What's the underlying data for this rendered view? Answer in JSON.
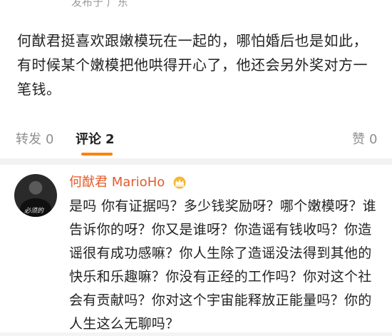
{
  "post": {
    "location": "发布于 广东",
    "text": "何猷君挺喜欢跟嫩模玩在一起的，哪怕婚后也是如此，有时候某个嫩模把他哄得开心了，他还会另外奖对方一笔钱。"
  },
  "actions": {
    "repost_label": "转发",
    "repost_count": "0",
    "comments_label": "评论",
    "comments_count": "2",
    "like_label": "赞",
    "like_count": "0"
  },
  "comment": {
    "username": "何猷君 MarioHo",
    "badge_icon": "crown-icon",
    "avatar_text": "必须的",
    "text": "是吗 你有证据吗？多少钱奖励呀？哪个嫩模呀？谁告诉你的呀？你又是谁呀？你造谣有钱收吗？你造谣很有成功感嘛？你人生除了造谣没法得到其他的快乐和乐趣嘛？你没有正经的工作吗？你对这个社会有贡献吗？你对这个宇宙能释放正能量吗？你的人生这么无聊吗？"
  },
  "colors": {
    "accent": "#ff8200",
    "username": "#e45a2a",
    "muted": "#8f8f8f"
  }
}
